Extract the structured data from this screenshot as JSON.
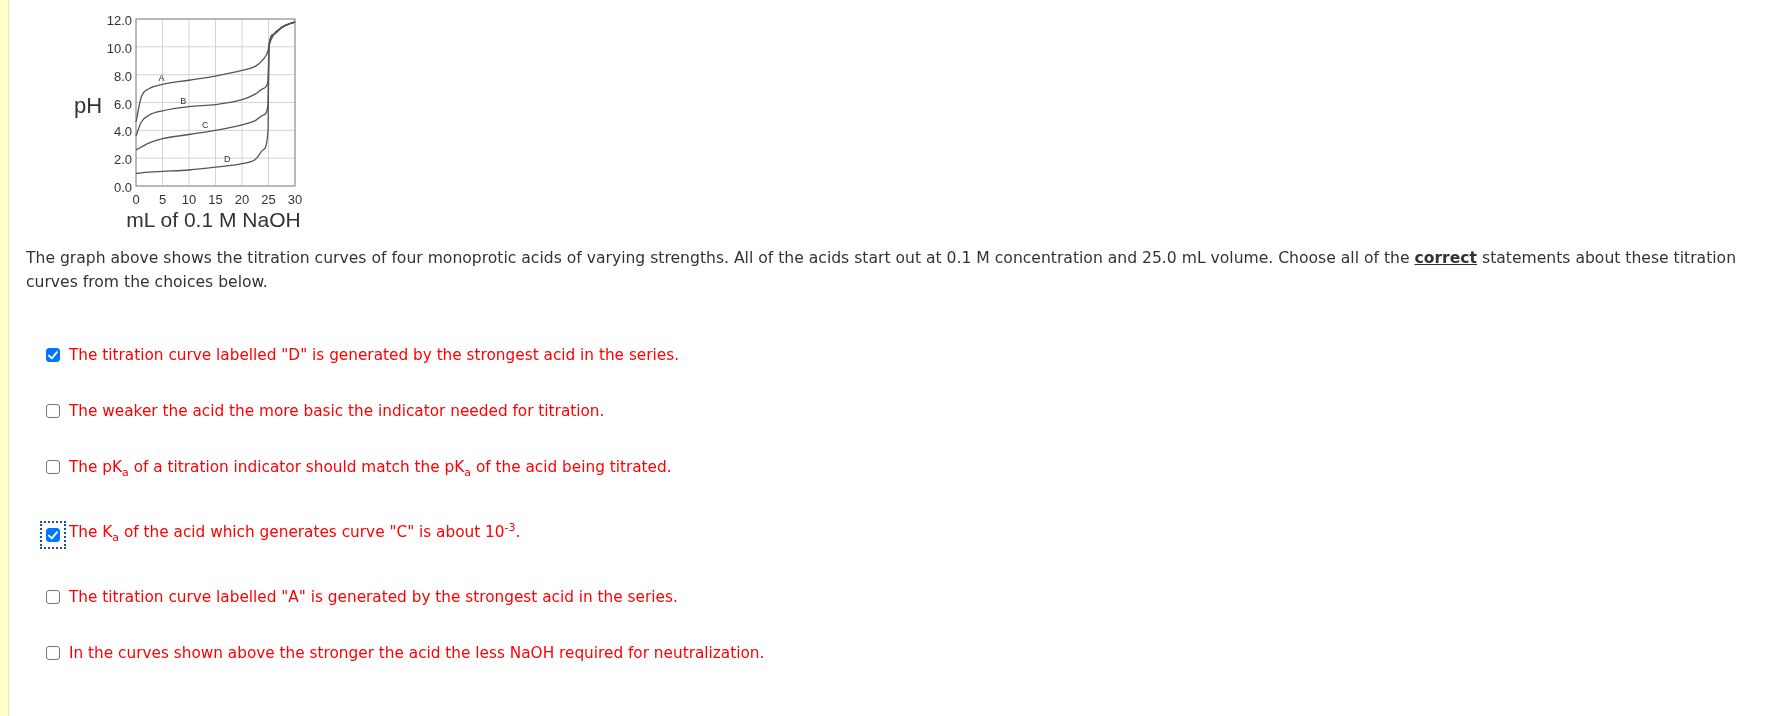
{
  "chart": {
    "chart_data": {
      "type": "line",
      "xlabel": "mL of 0.1 M NaOH",
      "ylabel": "pH",
      "x": [
        0,
        1,
        2.5,
        5,
        10,
        15,
        20,
        22.5,
        24,
        24.9,
        25.1,
        26,
        27.5,
        30
      ],
      "series": [
        {
          "color": "#555555",
          "values": [
            4.6,
            6.4,
            7.0,
            7.3,
            7.6,
            7.9,
            8.3,
            8.6,
            9.1,
            9.7,
            10.1,
            10.9,
            11.4,
            11.8
          ]
        },
        {
          "color": "#555555",
          "values": [
            3.6,
            4.6,
            5.1,
            5.4,
            5.7,
            5.85,
            6.2,
            6.6,
            7.0,
            7.5,
            10.1,
            10.9,
            11.4,
            11.8
          ]
        },
        {
          "color": "#555555",
          "values": [
            2.6,
            2.8,
            3.1,
            3.4,
            3.7,
            4.0,
            4.4,
            4.7,
            5.1,
            5.8,
            10.1,
            10.9,
            11.4,
            11.8
          ]
        },
        {
          "color": "#555555",
          "values": [
            0.9,
            0.95,
            1.0,
            1.05,
            1.15,
            1.35,
            1.6,
            1.9,
            2.6,
            3.9,
            10.1,
            10.9,
            11.4,
            11.8
          ]
        }
      ],
      "xlim": [
        0,
        30
      ],
      "ylim": [
        0,
        12
      ],
      "xticks": [
        0,
        5,
        10,
        15,
        20,
        25,
        30
      ],
      "yticks": [
        {
          "value": 0,
          "label": "0.0"
        },
        {
          "value": 2,
          "label": "2.0"
        },
        {
          "value": 4,
          "label": "4.0"
        },
        {
          "value": 6,
          "label": "6.0"
        },
        {
          "value": 8,
          "label": "8.0"
        },
        {
          "value": 10,
          "label": "10.0"
        },
        {
          "value": 12,
          "label": "12.0"
        }
      ],
      "grid": true,
      "annotations": [
        "A",
        "B",
        "C",
        "D"
      ]
    }
  },
  "question": "The graph above shows the titration curves of four monoprotic acids of varying strengths. All of the acids start out at 0.1 M concentration and 25.0 mL volume. Choose all of the **correct** statements about these titration curves from the choices below.",
  "choices": [
    {
      "text": "The titration curve labelled \"D\" is generated by the strongest acid in the series.",
      "checked": true,
      "focused": false
    },
    {
      "text": "The weaker the acid the more basic the indicator needed for titration.",
      "checked": false,
      "focused": false
    },
    {
      "text": "The pK$_{a}$ of a titration indicator should match the pK$_{a}$ of the acid being titrated.",
      "checked": false,
      "focused": false
    },
    {
      "text": "The K$_{a}$ of the acid which generates curve \"C\" is about 10$^{-3}$.",
      "checked": true,
      "focused": true
    },
    {
      "text": "The titration curve labelled \"A\" is generated by the strongest acid in the series.",
      "checked": false,
      "focused": false
    },
    {
      "text": "In the curves shown above the stronger the acid the less NaOH required for neutralization.",
      "checked": false,
      "focused": false
    }
  ]
}
